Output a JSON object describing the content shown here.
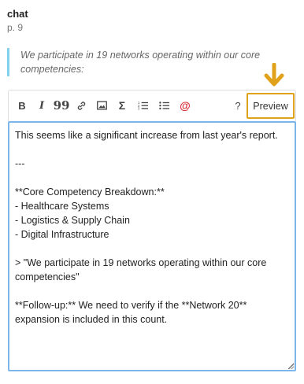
{
  "header": {
    "title": "chat",
    "page": "p. 9"
  },
  "quote": {
    "line1": "We participate in 19 networks operating within our core",
    "line2": "competencies:"
  },
  "toolbar": {
    "bold_label": "B",
    "italic_label": "I",
    "quote_label": "99",
    "sigma_label": "Σ",
    "mention_label": "@",
    "help_label": "?",
    "preview_label": "Preview"
  },
  "editor": {
    "value": "This seems like a significant increase from last year's report.\n\n---\n\n**Core Competency Breakdown:**\n- Healthcare Systems\n- Logistics & Supply Chain\n- Digital Infrastructure\n\n> \"We participate in 19 networks operating within our core competencies\"\n\n**Follow-up:** We need to verify if the **Network 20** expansion is included in this count."
  },
  "colors": {
    "accent_arrow": "#e0a21a",
    "quote_bar": "#7fd3ef",
    "editor_border": "#7cb6ea",
    "mention": "#d9303a"
  },
  "icons": [
    "link-icon",
    "image-icon",
    "ordered-list-icon",
    "bullet-list-icon",
    "arrow-down-icon"
  ]
}
